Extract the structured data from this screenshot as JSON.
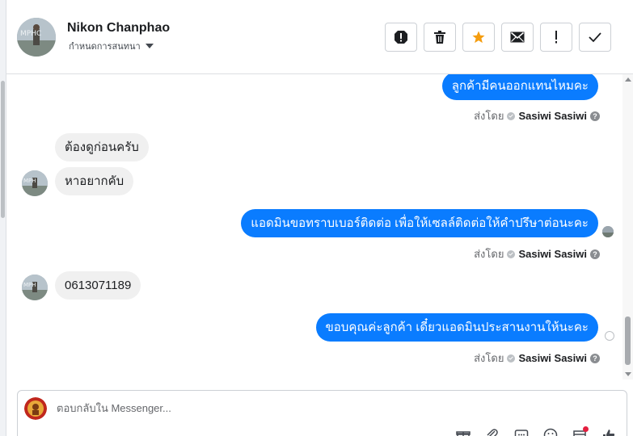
{
  "header": {
    "contact_name": "Nikon Chanphao",
    "assign_label": "กำหนดการสนทนา",
    "actions": [
      "report-spam-icon",
      "trash-icon",
      "star-icon",
      "envelope-icon",
      "exclamation-icon",
      "check-icon"
    ]
  },
  "messages": [
    {
      "direction": "out",
      "text": "ลูกค้ามีคนออกแทนไหมคะ",
      "sent_by_label": "ส่งโดย",
      "sender": "Sasiwi Sasiwi"
    },
    {
      "direction": "in",
      "text": "ต้องดูก่อนครับ"
    },
    {
      "direction": "in",
      "text": "หาอยากคับ"
    },
    {
      "direction": "out",
      "text": "แอดมินขอทราบเบอร์ติดต่อ เพื่อให้เซลล์ติดต่อให้คำปรึษาต่อนะคะ",
      "sent_by_label": "ส่งโดย",
      "sender": "Sasiwi Sasiwi"
    },
    {
      "direction": "in",
      "text": "0613071189"
    },
    {
      "direction": "out",
      "text": "ขอบคุณค่ะลูกค้า เดี๋ยวแอดมินประสานงานให้นะคะ",
      "sent_by_label": "ส่งโดย",
      "sender": "Sasiwi Sasiwi"
    }
  ],
  "composer": {
    "placeholder": "ตอบกลับใน Messenger...",
    "tools": [
      "gift-icon",
      "attachment-icon",
      "saved-reply-icon",
      "emoji-icon",
      "calendar-icon",
      "thumbs-up-icon"
    ]
  },
  "colors": {
    "outgoing_bubble": "#0a7cff",
    "incoming_bubble": "#f0f0f0",
    "star": "#f59d0f",
    "notification": "#e41e3f"
  }
}
